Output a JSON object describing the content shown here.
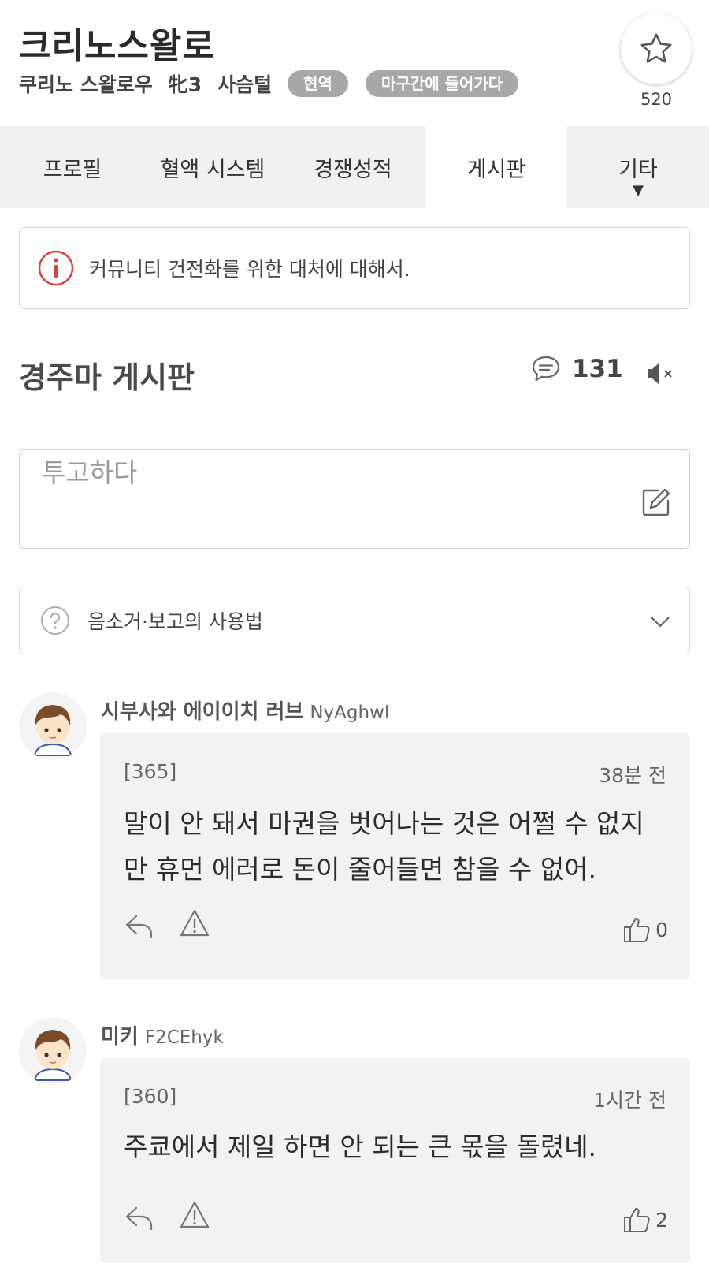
{
  "horse": {
    "name": "크리노스왈로",
    "subtitle_name": "쿠리노 스왈로우",
    "age_sex": "牝3",
    "coat": "사슴털",
    "badges": [
      "현역",
      "마구간에 들어가다"
    ]
  },
  "favorite": {
    "count": "520",
    "icon": "star-outline-icon"
  },
  "tabs": [
    {
      "label": "프로필",
      "active": false
    },
    {
      "label": "혈액 시스템",
      "active": false
    },
    {
      "label": "경쟁성적",
      "active": false
    },
    {
      "label": "게시판",
      "active": true
    },
    {
      "label": "기타",
      "active": false,
      "caret": "▼"
    }
  ],
  "notice": {
    "icon": "info-circle-icon",
    "text": "커뮤니티 건전화를 위한 대처에 대해서."
  },
  "board": {
    "title": "경주마 게시판",
    "comment_count": "131",
    "comment_icon": "speech-bubble-icon",
    "mute_icon": "speaker-muted-icon"
  },
  "post": {
    "placeholder": "투고하다",
    "icon": "edit-icon"
  },
  "help": {
    "icon": "question-circle-icon",
    "text": "음소거·보고의 사용법",
    "chevron": "chevron-down-icon"
  },
  "comments": [
    {
      "author": "시부사와 에이이치 러브",
      "author_id": "NyAghwI",
      "number": "[365]",
      "time": "38분 전",
      "text_lines": [
        "말이 안 돼서 마권을 벗어나는 것은 어쩔 수 없지",
        "만 휴먼 에러로 돈이 줄어들면 참을 수 없어."
      ],
      "likes": "0"
    },
    {
      "author": "미키",
      "author_id": "F2CEhyk",
      "number": "[360]",
      "time": "1시간 전",
      "text_lines": [
        "주쿄에서 제일 하면 안 되는 큰 몫을 돌렸네."
      ],
      "likes": "2"
    }
  ],
  "colors": {
    "badge_bg": "#a8a8a8",
    "tab_bar_bg": "#f1f1f1",
    "bubble_bg": "#f2f2f2",
    "info_red": "#d9443f"
  }
}
